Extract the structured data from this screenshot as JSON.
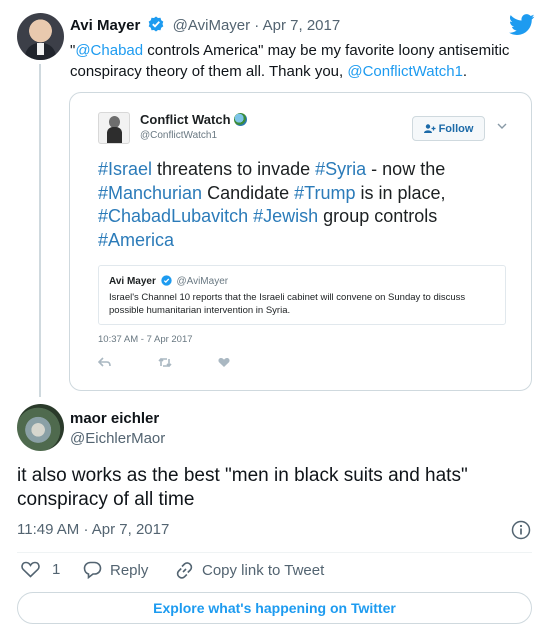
{
  "parent": {
    "name": "Avi Mayer",
    "handle": "@AviMayer",
    "separator": "·",
    "date": "Apr 7, 2017",
    "text_parts": [
      "\"",
      "@Chabad",
      " controls America\" may be my favorite loony antisemitic conspiracy theory of them all. Thank you, ",
      "@ConflictWatch1",
      "."
    ]
  },
  "quoted": {
    "name": "Conflict Watch",
    "handle": "@ConflictWatch1",
    "follow_label": "Follow",
    "text_parts": [
      "#Israel",
      " threatens to invade ",
      "#Syria",
      " - now the ",
      "#Manchurian",
      " Candidate ",
      "#Trump",
      " is in place, ",
      "#ChabadLubavitch",
      " ",
      "#Jewish",
      " group controls ",
      "#America"
    ],
    "inner": {
      "name": "Avi Mayer",
      "handle": "@AviMayer",
      "text": "Israel's Channel 10 reports that the Israeli cabinet will convene on Sunday to discuss possible humanitarian intervention in Syria."
    },
    "timestamp": "10:37 AM - 7 Apr 2017"
  },
  "reply": {
    "name": "maor eichler",
    "handle": "@EichlerMaor",
    "text": "it also works as the best \"men in black suits and hats\" conspiracy of all time",
    "time": "11:49 AM",
    "separator": "·",
    "date": "Apr 7, 2017",
    "like_count": "1",
    "reply_label": "Reply",
    "copy_label": "Copy link to Tweet",
    "explore_label": "Explore what's happening on Twitter"
  },
  "colors": {
    "accent": "#1d9bf0",
    "hashtag": "#2b7bb9",
    "text": "#0f1419",
    "muted": "#536471"
  }
}
